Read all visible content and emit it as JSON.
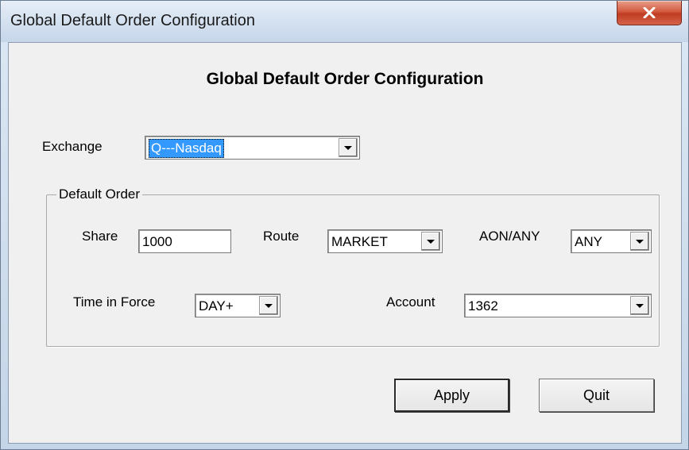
{
  "window": {
    "title": "Global Default Order Configuration",
    "close_label": "X"
  },
  "dialog": {
    "heading": "Global Default Order Configuration",
    "exchange": {
      "label": "Exchange",
      "value": "Q---Nasdaq"
    },
    "default_order": {
      "group_title": "Default Order",
      "share": {
        "label": "Share",
        "value": "1000"
      },
      "route": {
        "label": "Route",
        "value": "MARKET"
      },
      "aon_any": {
        "label": "AON/ANY",
        "value": "ANY"
      },
      "time_in_force": {
        "label": "Time in Force",
        "value": "DAY+"
      },
      "account": {
        "label": "Account",
        "value": "1362"
      }
    },
    "buttons": {
      "apply": "Apply",
      "quit": "Quit"
    }
  },
  "icons": {
    "close": "close-icon",
    "dropdown": "chevron-down-icon"
  },
  "colors": {
    "selection": "#3399ff",
    "close_button": "#c8452b"
  }
}
